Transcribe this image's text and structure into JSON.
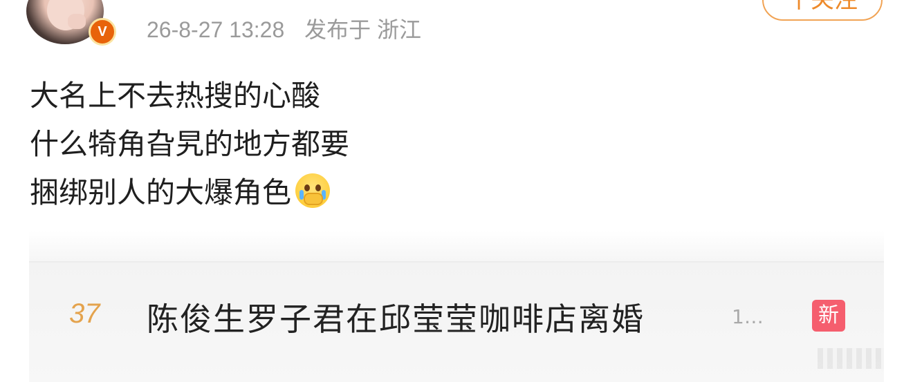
{
  "header": {
    "verified_badge": "V",
    "timestamp": "26-8-27 13:28",
    "location": "发布于 浙江",
    "follow_label": "十关注"
  },
  "post": {
    "lines": [
      "大名上不去热搜的心酸",
      "什么犄角旮旯的地方都要",
      "捆绑别人的大爆角色"
    ],
    "emoji": "crying-covering-mouth-emoji"
  },
  "hot_search": {
    "rank": "37",
    "topic": "陈俊生罗子君在邱莹莹咖啡店离婚",
    "count": "1…",
    "badge": "新",
    "badge_color": "#f55e6e",
    "rank_color": "#e4a34d"
  },
  "colors": {
    "accent": "#ee8a2a",
    "meta_text": "#9a9a9a"
  }
}
